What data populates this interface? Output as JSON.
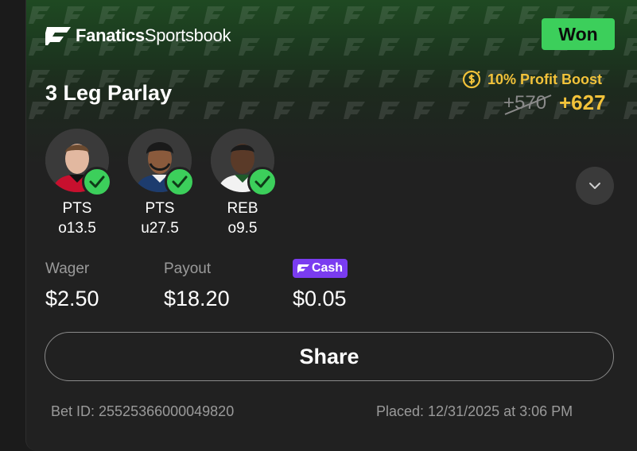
{
  "brand": {
    "name_bold": "Fanatics",
    "name_light": "Sportsbook"
  },
  "status": {
    "label": "Won",
    "color": "#3ccf5b"
  },
  "bet": {
    "title": "3 Leg Parlay"
  },
  "boost": {
    "label": "10% Profit Boost",
    "old_odds": "+570",
    "new_odds": "+627"
  },
  "legs": [
    {
      "stat": "PTS",
      "line": "o13.5",
      "result": "check-icon"
    },
    {
      "stat": "PTS",
      "line": "u27.5",
      "result": "check-icon"
    },
    {
      "stat": "REB",
      "line": "o9.5",
      "result": "check-icon"
    }
  ],
  "summary": {
    "wager_label": "Wager",
    "wager_value": "$2.50",
    "payout_label": "Payout",
    "payout_value": "$18.20",
    "cash_badge": "Cash",
    "cash_value": "$0.05"
  },
  "share": {
    "label": "Share"
  },
  "footer": {
    "bet_id": "Bet ID: 25525366000049820",
    "placed": "Placed: 12/31/2025 at 3:06 PM"
  },
  "colors": {
    "accent_gold": "#f2c23a",
    "cash_purple": "#7a3cf0"
  }
}
